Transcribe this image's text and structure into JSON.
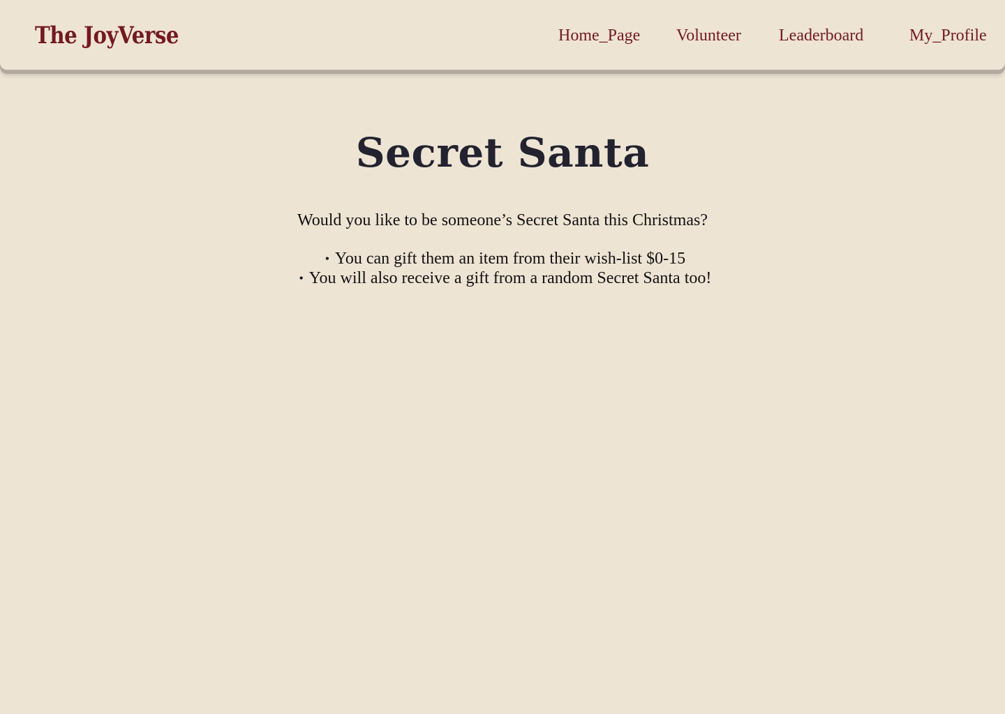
{
  "header": {
    "brand": "The JoyVerse",
    "nav": [
      {
        "label": "Home_Page"
      },
      {
        "label": "Volunteer"
      },
      {
        "label": "Leaderboard"
      },
      {
        "label": "My_Profile"
      }
    ]
  },
  "main": {
    "title": "Secret Santa",
    "intro": "Would you like to be someone’s Secret Santa this Christmas?",
    "bullets": [
      "You can gift them an item from their wish-list $0-15",
      "You will also receive a gift from a random Secret Santa too!"
    ]
  },
  "colors": {
    "background": "#EEE4D4",
    "brand_red": "#731A1F",
    "title_navy": "#23232F",
    "header_shadow": "#B3ABA0"
  }
}
